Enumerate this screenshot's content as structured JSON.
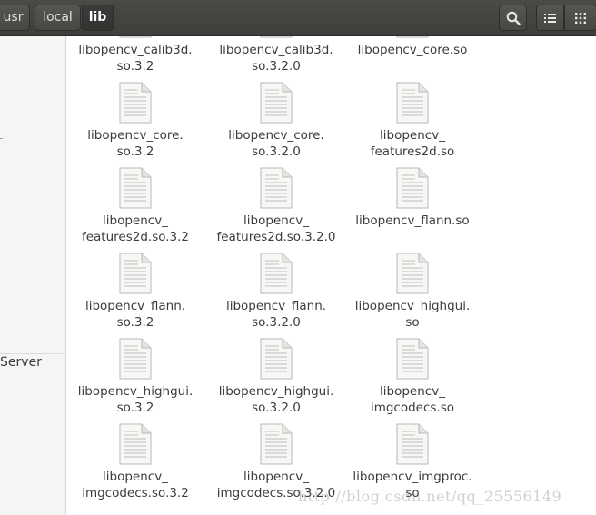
{
  "breadcrumb": {
    "items": [
      {
        "label": "usr"
      },
      {
        "label": "local"
      },
      {
        "label": "lib"
      }
    ]
  },
  "toolbar": {
    "search_icon": "search-icon",
    "list_view_icon": "list-view-icon",
    "grid_view_icon": "grid-view-icon"
  },
  "sidebar": {
    "items": [
      {
        "label": "Server"
      }
    ]
  },
  "files": [
    {
      "line1": "libopencv_calib3d.",
      "line2": "so.3.2"
    },
    {
      "line1": "libopencv_calib3d.",
      "line2": "so.3.2.0"
    },
    {
      "line1": "libopencv_core.so",
      "line2": ""
    },
    {
      "line1": "libopencv_core.",
      "line2": "so.3.2"
    },
    {
      "line1": "libopencv_core.",
      "line2": "so.3.2.0"
    },
    {
      "line1": "libopencv_",
      "line2": "features2d.so"
    },
    {
      "line1": "libopencv_",
      "line2": "features2d.so.3.2"
    },
    {
      "line1": "libopencv_",
      "line2": "features2d.so.3.2.0"
    },
    {
      "line1": "libopencv_flann.so",
      "line2": ""
    },
    {
      "line1": "libopencv_flann.",
      "line2": "so.3.2"
    },
    {
      "line1": "libopencv_flann.",
      "line2": "so.3.2.0"
    },
    {
      "line1": "libopencv_highgui.",
      "line2": "so"
    },
    {
      "line1": "libopencv_highgui.",
      "line2": "so.3.2"
    },
    {
      "line1": "libopencv_highgui.",
      "line2": "so.3.2.0"
    },
    {
      "line1": "libopencv_",
      "line2": "imgcodecs.so"
    },
    {
      "line1": "libopencv_",
      "line2": "imgcodecs.so.3.2"
    },
    {
      "line1": "libopencv_",
      "line2": "imgcodecs.so.3.2.0"
    },
    {
      "line1": "libopencv_imgproc.",
      "line2": "so"
    }
  ],
  "watermark": "http://blog.csdn.net/qq_25556149",
  "colors": {
    "header": "#3e3e3b",
    "sidebar": "#f5f5f4",
    "text": "#3c3c3c"
  }
}
